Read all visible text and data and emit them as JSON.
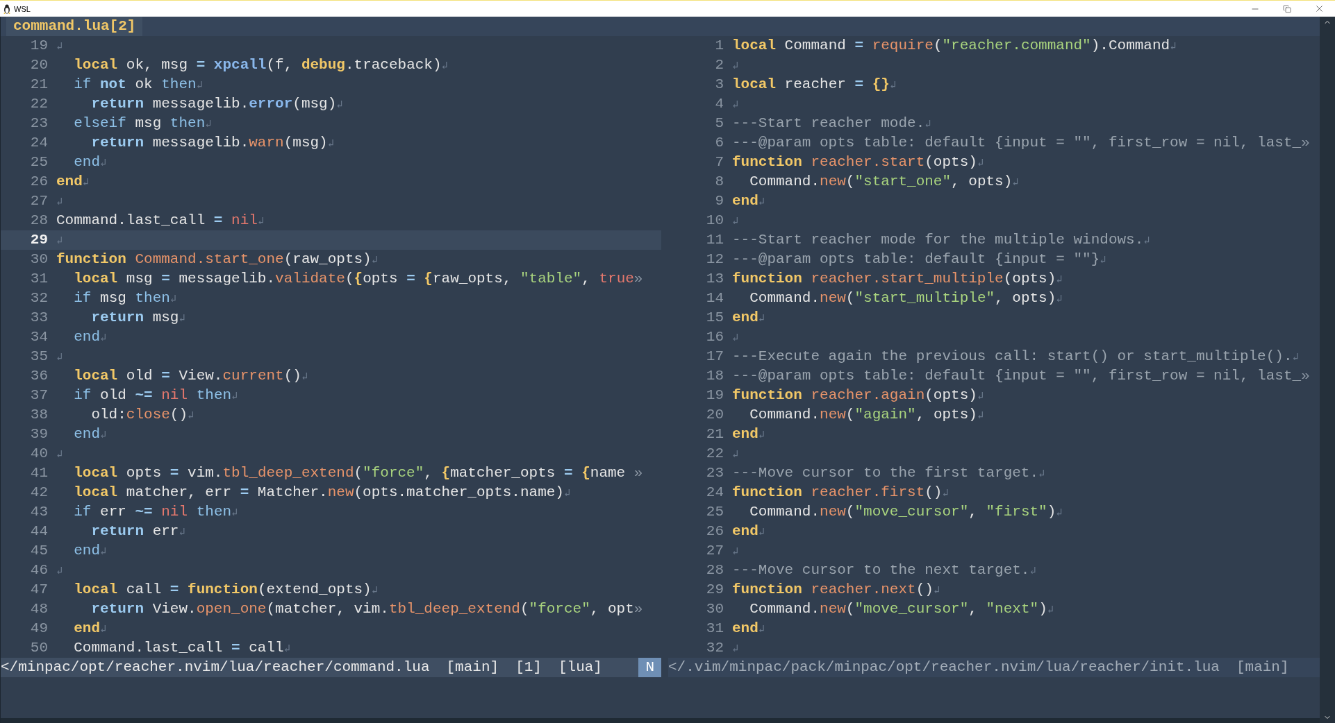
{
  "window": {
    "title": "WSL"
  },
  "tab": {
    "label": "command.lua[2]",
    "selected": true
  },
  "panes": [
    {
      "active": true,
      "lines": [
        {
          "number": "19",
          "current": false,
          "eol": "↲"
        },
        {
          "number": "20",
          "current": false,
          "tokens": [
            {
              "kind": "keyword",
              "text": "  local"
            },
            {
              "kind": "plain",
              "text": " ok, msg "
            },
            {
              "kind": "operator",
              "text": "= "
            },
            {
              "kind": "builtin",
              "text": "xpcall"
            },
            {
              "kind": "plain",
              "text": "(f, "
            },
            {
              "kind": "module",
              "text": "debug"
            },
            {
              "kind": "plain",
              "text": ".traceback)"
            }
          ],
          "eol": "↲"
        },
        {
          "number": "21",
          "current": false,
          "tokens": [
            {
              "kind": "conditional",
              "text": "  if "
            },
            {
              "kind": "statement",
              "text": "not"
            },
            {
              "kind": "plain",
              "text": " ok "
            },
            {
              "kind": "conditional",
              "text": "then"
            }
          ],
          "eol": "↲"
        },
        {
          "number": "22",
          "current": false,
          "tokens": [
            {
              "kind": "statement",
              "text": "    return"
            },
            {
              "kind": "plain",
              "text": " messagelib."
            },
            {
              "kind": "builtin",
              "text": "error"
            },
            {
              "kind": "plain",
              "text": "(msg)"
            }
          ],
          "eol": "↲"
        },
        {
          "number": "23",
          "current": false,
          "tokens": [
            {
              "kind": "conditional",
              "text": "  elseif"
            },
            {
              "kind": "plain",
              "text": " msg "
            },
            {
              "kind": "conditional",
              "text": "then"
            }
          ],
          "eol": "↲"
        },
        {
          "number": "24",
          "current": false,
          "tokens": [
            {
              "kind": "statement",
              "text": "    return"
            },
            {
              "kind": "plain",
              "text": " messagelib."
            },
            {
              "kind": "call",
              "text": "warn"
            },
            {
              "kind": "plain",
              "text": "(msg)"
            }
          ],
          "eol": "↲"
        },
        {
          "number": "25",
          "current": false,
          "tokens": [
            {
              "kind": "conditional",
              "text": "  end"
            }
          ],
          "eol": "↲"
        },
        {
          "number": "26",
          "current": false,
          "tokens": [
            {
              "kind": "keyword",
              "text": "end"
            }
          ],
          "eol": "↲"
        },
        {
          "number": "27",
          "current": false,
          "eol": "↲"
        },
        {
          "number": "28",
          "current": false,
          "tokens": [
            {
              "kind": "plain",
              "text": "Command.last_call "
            },
            {
              "kind": "operator",
              "text": "= "
            },
            {
              "kind": "constant",
              "text": "nil"
            }
          ],
          "eol": "↲"
        },
        {
          "number": "29",
          "current": true,
          "eol": "↲"
        },
        {
          "number": "30",
          "current": false,
          "tokens": [
            {
              "kind": "keyword",
              "text": "function "
            },
            {
              "kind": "call",
              "text": "Command.start_one"
            },
            {
              "kind": "plain",
              "text": "(raw_opts)"
            }
          ],
          "eol": "↲"
        },
        {
          "number": "31",
          "current": false,
          "tokens": [
            {
              "kind": "keyword",
              "text": "  local"
            },
            {
              "kind": "plain",
              "text": " msg "
            },
            {
              "kind": "operator",
              "text": "="
            },
            {
              "kind": "plain",
              "text": " messagelib."
            },
            {
              "kind": "call",
              "text": "validate"
            },
            {
              "kind": "plain",
              "text": "("
            },
            {
              "kind": "brace",
              "text": "{"
            },
            {
              "kind": "plain",
              "text": "opts "
            },
            {
              "kind": "operator",
              "text": "= "
            },
            {
              "kind": "brace",
              "text": "{"
            },
            {
              "kind": "plain",
              "text": "raw_opts, "
            },
            {
              "kind": "string",
              "text": "\"table\""
            },
            {
              "kind": "plain",
              "text": ", "
            },
            {
              "kind": "constant",
              "text": "true"
            }
          ],
          "more": "»"
        },
        {
          "number": "32",
          "current": false,
          "tokens": [
            {
              "kind": "conditional",
              "text": "  if"
            },
            {
              "kind": "plain",
              "text": " msg "
            },
            {
              "kind": "conditional",
              "text": "then"
            }
          ],
          "eol": "↲"
        },
        {
          "number": "33",
          "current": false,
          "tokens": [
            {
              "kind": "statement",
              "text": "    return"
            },
            {
              "kind": "plain",
              "text": " msg"
            }
          ],
          "eol": "↲"
        },
        {
          "number": "34",
          "current": false,
          "tokens": [
            {
              "kind": "conditional",
              "text": "  end"
            }
          ],
          "eol": "↲"
        },
        {
          "number": "35",
          "current": false,
          "eol": "↲"
        },
        {
          "number": "36",
          "current": false,
          "tokens": [
            {
              "kind": "keyword",
              "text": "  local"
            },
            {
              "kind": "plain",
              "text": " old "
            },
            {
              "kind": "operator",
              "text": "="
            },
            {
              "kind": "plain",
              "text": " View."
            },
            {
              "kind": "call",
              "text": "current"
            },
            {
              "kind": "plain",
              "text": "()"
            }
          ],
          "eol": "↲"
        },
        {
          "number": "37",
          "current": false,
          "tokens": [
            {
              "kind": "conditional",
              "text": "  if"
            },
            {
              "kind": "plain",
              "text": " old "
            },
            {
              "kind": "operator",
              "text": "~= "
            },
            {
              "kind": "constant",
              "text": "nil "
            },
            {
              "kind": "conditional",
              "text": "then"
            }
          ],
          "eol": "↲"
        },
        {
          "number": "38",
          "current": false,
          "tokens": [
            {
              "kind": "plain",
              "text": "    old:"
            },
            {
              "kind": "call",
              "text": "close"
            },
            {
              "kind": "plain",
              "text": "()"
            }
          ],
          "eol": "↲"
        },
        {
          "number": "39",
          "current": false,
          "tokens": [
            {
              "kind": "conditional",
              "text": "  end"
            }
          ],
          "eol": "↲"
        },
        {
          "number": "40",
          "current": false,
          "eol": "↲"
        },
        {
          "number": "41",
          "current": false,
          "tokens": [
            {
              "kind": "keyword",
              "text": "  local"
            },
            {
              "kind": "plain",
              "text": " opts "
            },
            {
              "kind": "operator",
              "text": "="
            },
            {
              "kind": "plain",
              "text": " vim."
            },
            {
              "kind": "call",
              "text": "tbl_deep_extend"
            },
            {
              "kind": "plain",
              "text": "("
            },
            {
              "kind": "string",
              "text": "\"force\""
            },
            {
              "kind": "plain",
              "text": ", "
            },
            {
              "kind": "brace",
              "text": "{"
            },
            {
              "kind": "plain",
              "text": "matcher_opts "
            },
            {
              "kind": "operator",
              "text": "= "
            },
            {
              "kind": "brace",
              "text": "{"
            },
            {
              "kind": "plain",
              "text": "name "
            }
          ],
          "more": "»"
        },
        {
          "number": "42",
          "current": false,
          "tokens": [
            {
              "kind": "keyword",
              "text": "  local"
            },
            {
              "kind": "plain",
              "text": " matcher, err "
            },
            {
              "kind": "operator",
              "text": "="
            },
            {
              "kind": "plain",
              "text": " Matcher."
            },
            {
              "kind": "call",
              "text": "new"
            },
            {
              "kind": "plain",
              "text": "(opts.matcher_opts.name)"
            }
          ],
          "eol": "↲"
        },
        {
          "number": "43",
          "current": false,
          "tokens": [
            {
              "kind": "conditional",
              "text": "  if"
            },
            {
              "kind": "plain",
              "text": " err "
            },
            {
              "kind": "operator",
              "text": "~= "
            },
            {
              "kind": "constant",
              "text": "nil "
            },
            {
              "kind": "conditional",
              "text": "then"
            }
          ],
          "eol": "↲"
        },
        {
          "number": "44",
          "current": false,
          "tokens": [
            {
              "kind": "statement",
              "text": "    return"
            },
            {
              "kind": "plain",
              "text": " err"
            }
          ],
          "eol": "↲"
        },
        {
          "number": "45",
          "current": false,
          "tokens": [
            {
              "kind": "conditional",
              "text": "  end"
            }
          ],
          "eol": "↲"
        },
        {
          "number": "46",
          "current": false,
          "eol": "↲"
        },
        {
          "number": "47",
          "current": false,
          "tokens": [
            {
              "kind": "keyword",
              "text": "  local"
            },
            {
              "kind": "plain",
              "text": " call "
            },
            {
              "kind": "operator",
              "text": "= "
            },
            {
              "kind": "keyword",
              "text": "function"
            },
            {
              "kind": "plain",
              "text": "(extend_opts)"
            }
          ],
          "eol": "↲"
        },
        {
          "number": "48",
          "current": false,
          "tokens": [
            {
              "kind": "statement",
              "text": "    return"
            },
            {
              "kind": "plain",
              "text": " View."
            },
            {
              "kind": "call",
              "text": "open_one"
            },
            {
              "kind": "plain",
              "text": "(matcher, vim."
            },
            {
              "kind": "call",
              "text": "tbl_deep_extend"
            },
            {
              "kind": "plain",
              "text": "("
            },
            {
              "kind": "string",
              "text": "\"force\""
            },
            {
              "kind": "plain",
              "text": ", opt"
            }
          ],
          "more": "»"
        },
        {
          "number": "49",
          "current": false,
          "tokens": [
            {
              "kind": "keyword",
              "text": "  end"
            }
          ],
          "eol": "↲"
        },
        {
          "number": "50",
          "current": false,
          "tokens": [
            {
              "kind": "plain",
              "text": "  Command.last_call "
            },
            {
              "kind": "operator",
              "text": "="
            },
            {
              "kind": "plain",
              "text": " call"
            }
          ],
          "eol": "↲"
        }
      ],
      "status": {
        "items": [
          "</minpac/opt/reacher.nvim/lua/reacher/command.lua",
          "[main]",
          "[1]",
          "[lua]"
        ],
        "mode": "N"
      }
    },
    {
      "active": false,
      "lines": [
        {
          "number": "1",
          "current": false,
          "tokens": [
            {
              "kind": "keyword",
              "text": "local"
            },
            {
              "kind": "plain",
              "text": " Command "
            },
            {
              "kind": "operator",
              "text": "= "
            },
            {
              "kind": "call",
              "text": "require"
            },
            {
              "kind": "plain",
              "text": "("
            },
            {
              "kind": "string",
              "text": "\"reacher.command\""
            },
            {
              "kind": "plain",
              "text": ").Command"
            }
          ],
          "eol": "↲"
        },
        {
          "number": "2",
          "current": false,
          "eol": "↲"
        },
        {
          "number": "3",
          "current": false,
          "tokens": [
            {
              "kind": "keyword",
              "text": "local"
            },
            {
              "kind": "plain",
              "text": " reacher "
            },
            {
              "kind": "operator",
              "text": "= "
            },
            {
              "kind": "brace",
              "text": "{}"
            }
          ],
          "eol": "↲"
        },
        {
          "number": "4",
          "current": false,
          "eol": "↲"
        },
        {
          "number": "5",
          "current": false,
          "tokens": [
            {
              "kind": "comment",
              "text": "---Start reacher mode."
            }
          ],
          "eol": "↲"
        },
        {
          "number": "6",
          "current": false,
          "tokens": [
            {
              "kind": "comment",
              "text": "---@param opts table: default {input = \"\", first_row = nil, last_"
            }
          ],
          "more": "»"
        },
        {
          "number": "7",
          "current": false,
          "tokens": [
            {
              "kind": "keyword",
              "text": "function "
            },
            {
              "kind": "call",
              "text": "reacher.start"
            },
            {
              "kind": "plain",
              "text": "(opts)"
            }
          ],
          "eol": "↲"
        },
        {
          "number": "8",
          "current": false,
          "tokens": [
            {
              "kind": "plain",
              "text": "  Command."
            },
            {
              "kind": "call",
              "text": "new"
            },
            {
              "kind": "plain",
              "text": "("
            },
            {
              "kind": "string",
              "text": "\"start_one\""
            },
            {
              "kind": "plain",
              "text": ", opts)"
            }
          ],
          "eol": "↲"
        },
        {
          "number": "9",
          "current": false,
          "tokens": [
            {
              "kind": "keyword",
              "text": "end"
            }
          ],
          "eol": "↲"
        },
        {
          "number": "10",
          "current": false,
          "eol": "↲"
        },
        {
          "number": "11",
          "current": false,
          "tokens": [
            {
              "kind": "comment",
              "text": "---Start reacher mode for the multiple windows."
            }
          ],
          "eol": "↲"
        },
        {
          "number": "12",
          "current": false,
          "tokens": [
            {
              "kind": "comment",
              "text": "---@param opts table: default {input = \"\"}"
            }
          ],
          "eol": "↲"
        },
        {
          "number": "13",
          "current": false,
          "tokens": [
            {
              "kind": "keyword",
              "text": "function "
            },
            {
              "kind": "call",
              "text": "reacher.start_multiple"
            },
            {
              "kind": "plain",
              "text": "(opts)"
            }
          ],
          "eol": "↲"
        },
        {
          "number": "14",
          "current": false,
          "tokens": [
            {
              "kind": "plain",
              "text": "  Command."
            },
            {
              "kind": "call",
              "text": "new"
            },
            {
              "kind": "plain",
              "text": "("
            },
            {
              "kind": "string",
              "text": "\"start_multiple\""
            },
            {
              "kind": "plain",
              "text": ", opts)"
            }
          ],
          "eol": "↲"
        },
        {
          "number": "15",
          "current": false,
          "tokens": [
            {
              "kind": "keyword",
              "text": "end"
            }
          ],
          "eol": "↲"
        },
        {
          "number": "16",
          "current": false,
          "eol": "↲"
        },
        {
          "number": "17",
          "current": false,
          "tokens": [
            {
              "kind": "comment",
              "text": "---Execute again the previous call: start() or start_multiple()."
            }
          ],
          "eol": "↲"
        },
        {
          "number": "18",
          "current": false,
          "tokens": [
            {
              "kind": "comment",
              "text": "---@param opts table: default {input = \"\", first_row = nil, last_"
            }
          ],
          "more": "»"
        },
        {
          "number": "19",
          "current": false,
          "tokens": [
            {
              "kind": "keyword",
              "text": "function "
            },
            {
              "kind": "call",
              "text": "reacher.again"
            },
            {
              "kind": "plain",
              "text": "(opts)"
            }
          ],
          "eol": "↲"
        },
        {
          "number": "20",
          "current": false,
          "tokens": [
            {
              "kind": "plain",
              "text": "  Command."
            },
            {
              "kind": "call",
              "text": "new"
            },
            {
              "kind": "plain",
              "text": "("
            },
            {
              "kind": "string",
              "text": "\"again\""
            },
            {
              "kind": "plain",
              "text": ", opts)"
            }
          ],
          "eol": "↲"
        },
        {
          "number": "21",
          "current": false,
          "tokens": [
            {
              "kind": "keyword",
              "text": "end"
            }
          ],
          "eol": "↲"
        },
        {
          "number": "22",
          "current": false,
          "eol": "↲"
        },
        {
          "number": "23",
          "current": false,
          "tokens": [
            {
              "kind": "comment",
              "text": "---Move cursor to the first target."
            }
          ],
          "eol": "↲"
        },
        {
          "number": "24",
          "current": false,
          "tokens": [
            {
              "kind": "keyword",
              "text": "function "
            },
            {
              "kind": "call",
              "text": "reacher.first"
            },
            {
              "kind": "plain",
              "text": "()"
            }
          ],
          "eol": "↲"
        },
        {
          "number": "25",
          "current": false,
          "tokens": [
            {
              "kind": "plain",
              "text": "  Command."
            },
            {
              "kind": "call",
              "text": "new"
            },
            {
              "kind": "plain",
              "text": "("
            },
            {
              "kind": "string",
              "text": "\"move_cursor\""
            },
            {
              "kind": "plain",
              "text": ", "
            },
            {
              "kind": "string",
              "text": "\"first\""
            },
            {
              "kind": "plain",
              "text": ")"
            }
          ],
          "eol": "↲"
        },
        {
          "number": "26",
          "current": false,
          "tokens": [
            {
              "kind": "keyword",
              "text": "end"
            }
          ],
          "eol": "↲"
        },
        {
          "number": "27",
          "current": false,
          "eol": "↲"
        },
        {
          "number": "28",
          "current": false,
          "tokens": [
            {
              "kind": "comment",
              "text": "---Move cursor to the next target."
            }
          ],
          "eol": "↲"
        },
        {
          "number": "29",
          "current": false,
          "tokens": [
            {
              "kind": "keyword",
              "text": "function "
            },
            {
              "kind": "call",
              "text": "reacher.next"
            },
            {
              "kind": "plain",
              "text": "()"
            }
          ],
          "eol": "↲"
        },
        {
          "number": "30",
          "current": false,
          "tokens": [
            {
              "kind": "plain",
              "text": "  Command."
            },
            {
              "kind": "call",
              "text": "new"
            },
            {
              "kind": "plain",
              "text": "("
            },
            {
              "kind": "string",
              "text": "\"move_cursor\""
            },
            {
              "kind": "plain",
              "text": ", "
            },
            {
              "kind": "string",
              "text": "\"next\""
            },
            {
              "kind": "plain",
              "text": ")"
            }
          ],
          "eol": "↲"
        },
        {
          "number": "31",
          "current": false,
          "tokens": [
            {
              "kind": "keyword",
              "text": "end"
            }
          ],
          "eol": "↲"
        },
        {
          "number": "32",
          "current": false,
          "eol": "↲"
        }
      ],
      "status": {
        "items": [
          "</.vim/minpac/pack/minpac/opt/reacher.nvim/lua/reacher/init.lua",
          "[main]"
        ]
      }
    }
  ]
}
